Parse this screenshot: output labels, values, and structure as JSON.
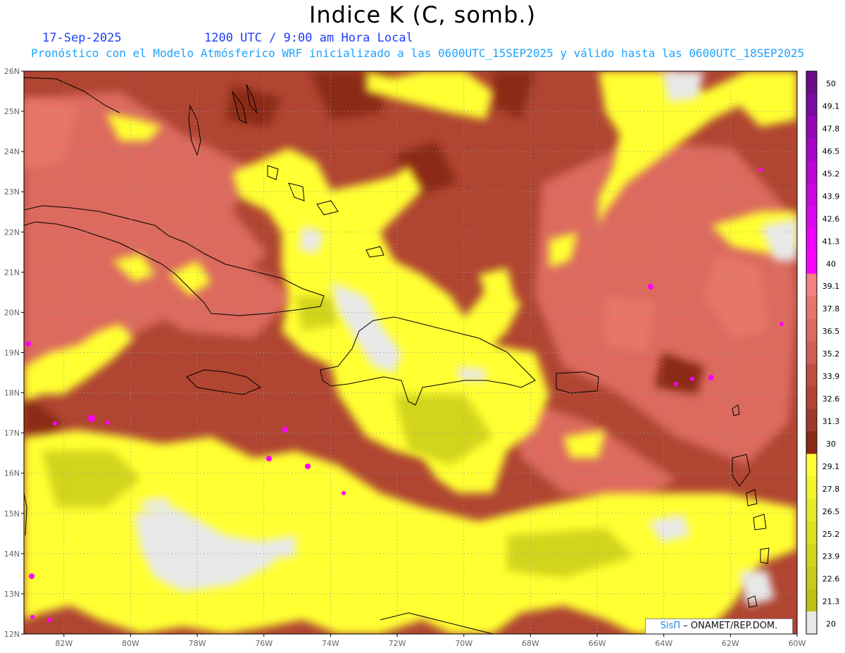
{
  "header": {
    "title": "Indice K (C, somb.)",
    "date": "17-Sep-2025",
    "time": "1200 UTC / 9:00 am Hora Local",
    "subtitle": "Pronóstico con el Modelo Atmósferico WRF inicializado a las 0600UTC_15SEP2025 y válido hasta las  0600UTC_18SEP2025"
  },
  "map": {
    "lat_labels": [
      "26N",
      "25N",
      "24N",
      "23N",
      "22N",
      "21N",
      "20N",
      "19N",
      "18N",
      "17N",
      "16N",
      "15N",
      "14N",
      "13N",
      "12N"
    ],
    "lon_labels": [
      "82W",
      "80W",
      "78W",
      "76W",
      "74W",
      "72W",
      "70W",
      "68W",
      "66W",
      "64W",
      "62W",
      "60W"
    ],
    "lat_range": [
      12,
      26
    ],
    "lon_range": [
      -83.2,
      -60
    ]
  },
  "colorbar": {
    "labels": [
      "50",
      "49.1",
      "47.8",
      "46.5",
      "45.2",
      "43.9",
      "42.6",
      "41.3",
      "40",
      "39.1",
      "37.8",
      "36.5",
      "35.2",
      "33.9",
      "32.6",
      "31.3",
      "30",
      "29.1",
      "27.8",
      "26.5",
      "25.2",
      "23.9",
      "22.6",
      "21.3",
      "20"
    ],
    "colors": [
      "#6a0d8a",
      "#7d0aa0",
      "#9408b8",
      "#a806c8",
      "#bb05d6",
      "#cc05e2",
      "#dd08ee",
      "#f000fb",
      "#ff00ff",
      "#f48280",
      "#e87668",
      "#dc6a5e",
      "#d06054",
      "#c0503f",
      "#b04532",
      "#a03a28",
      "#8b2a14",
      "#ffff33",
      "#f4f42e",
      "#e8ea28",
      "#dcdf22",
      "#d3d41e",
      "#c9ca1a",
      "#c0c016",
      "#e8e8e8"
    ]
  },
  "credit": {
    "brand": "SisΠ",
    "text": "–  ONAMET/REP.DOM."
  }
}
